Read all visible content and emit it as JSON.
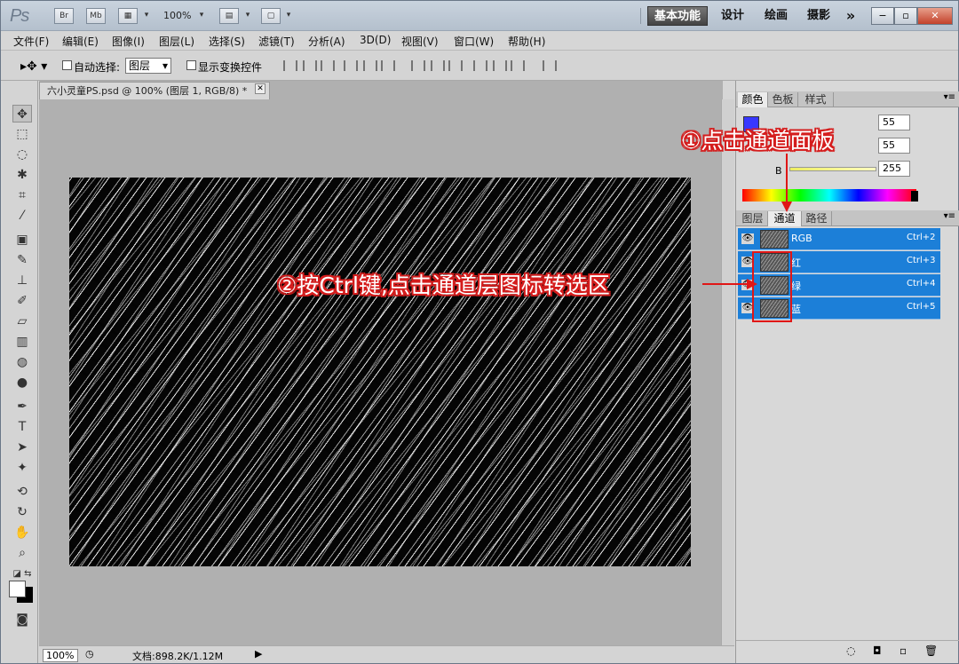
{
  "app": {
    "logo": "Ps",
    "zoom": "100%",
    "workspaces": [
      "基本功能",
      "设计",
      "绘画",
      "摄影"
    ],
    "more": "»"
  },
  "menu": [
    "文件(F)",
    "编辑(E)",
    "图像(I)",
    "图层(L)",
    "选择(S)",
    "滤镜(T)",
    "分析(A)",
    "3D(D)",
    "视图(V)",
    "窗口(W)",
    "帮助(H)"
  ],
  "options": {
    "auto_select_label": "自动选择:",
    "auto_select_value": "图层",
    "show_transform_label": "显示变换控件"
  },
  "document": {
    "tab_title": "六小灵童PS.psd @ 100% (图层 1, RGB/8) *",
    "zoom": "100%",
    "doc_info": "文档:898.2K/1.12M"
  },
  "color_panel": {
    "tabs": [
      "颜色",
      "色板",
      "样式"
    ],
    "values": [
      "55",
      "55",
      "255"
    ],
    "b_label": "B"
  },
  "channels_panel": {
    "tabs": [
      "图层",
      "通道",
      "路径"
    ],
    "channels": [
      {
        "name": "RGB",
        "shortcut": "Ctrl+2"
      },
      {
        "name": "红",
        "shortcut": "Ctrl+3"
      },
      {
        "name": "绿",
        "shortcut": "Ctrl+4"
      },
      {
        "name": "蓝",
        "shortcut": "Ctrl+5"
      }
    ]
  },
  "annotations": {
    "step1": "①点击通道面板",
    "step2": "②按Ctrl键,点击通道层图标转选区"
  },
  "colors": {
    "selection_blue": "#1c7fd8",
    "annotation_red": "#e01616"
  }
}
